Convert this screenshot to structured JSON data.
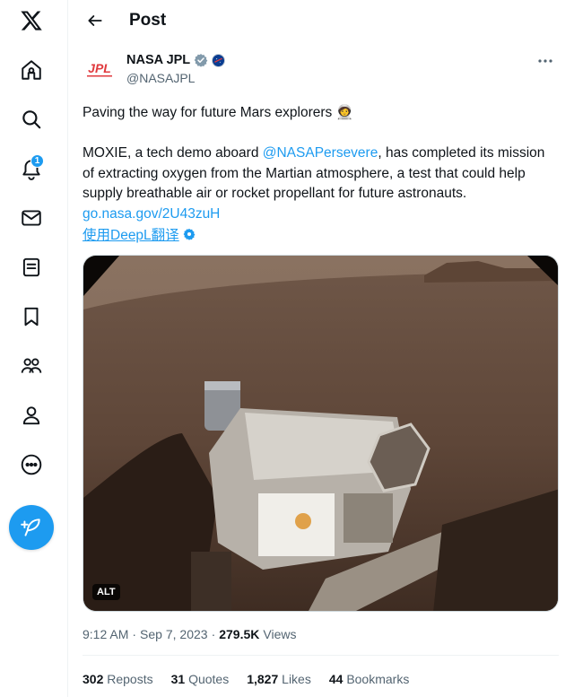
{
  "header": {
    "title": "Post"
  },
  "nav": {
    "items": [
      {
        "name": "x-logo-icon"
      },
      {
        "name": "home-icon"
      },
      {
        "name": "search-icon"
      },
      {
        "name": "notifications-icon",
        "badge": "1"
      },
      {
        "name": "messages-icon"
      },
      {
        "name": "lists-icon"
      },
      {
        "name": "bookmarks-icon"
      },
      {
        "name": "communities-icon"
      },
      {
        "name": "profile-icon"
      },
      {
        "name": "more-icon"
      }
    ],
    "compose_icon": "compose-feather-icon"
  },
  "post": {
    "author_name": "NASA JPL",
    "author_handle": "@NASAJPL",
    "avatar_text": "JPL",
    "line1": "Paving the way for future Mars explorers ",
    "line1_emoji": "🧑‍🚀",
    "body_before": "MOXIE, a tech demo aboard ",
    "mention": "@NASAPersevere",
    "body_after": ", has completed its mission of extracting oxygen from the Martian atmosphere, a test that could help supply breathable air or rocket propellant for future astronauts. ",
    "url": "go.nasa.gov/2U43zuH",
    "translate": "使用DeepL翻译",
    "alt_badge": "ALT",
    "time": "9:12 AM",
    "date": "Sep 7, 2023",
    "sep": "·",
    "views_count": "279.5K",
    "views_label": "Views",
    "stats": {
      "reposts_count": "302",
      "reposts_label": "Reposts",
      "quotes_count": "31",
      "quotes_label": "Quotes",
      "likes_count": "1,827",
      "likes_label": "Likes",
      "bookmarks_count": "44",
      "bookmarks_label": "Bookmarks"
    }
  },
  "colors": {
    "accent": "#1d9bf0",
    "text": "#0f1419",
    "muted": "#536471",
    "verified_gold": "#829aab",
    "jpl_red": "#e03a3e"
  }
}
